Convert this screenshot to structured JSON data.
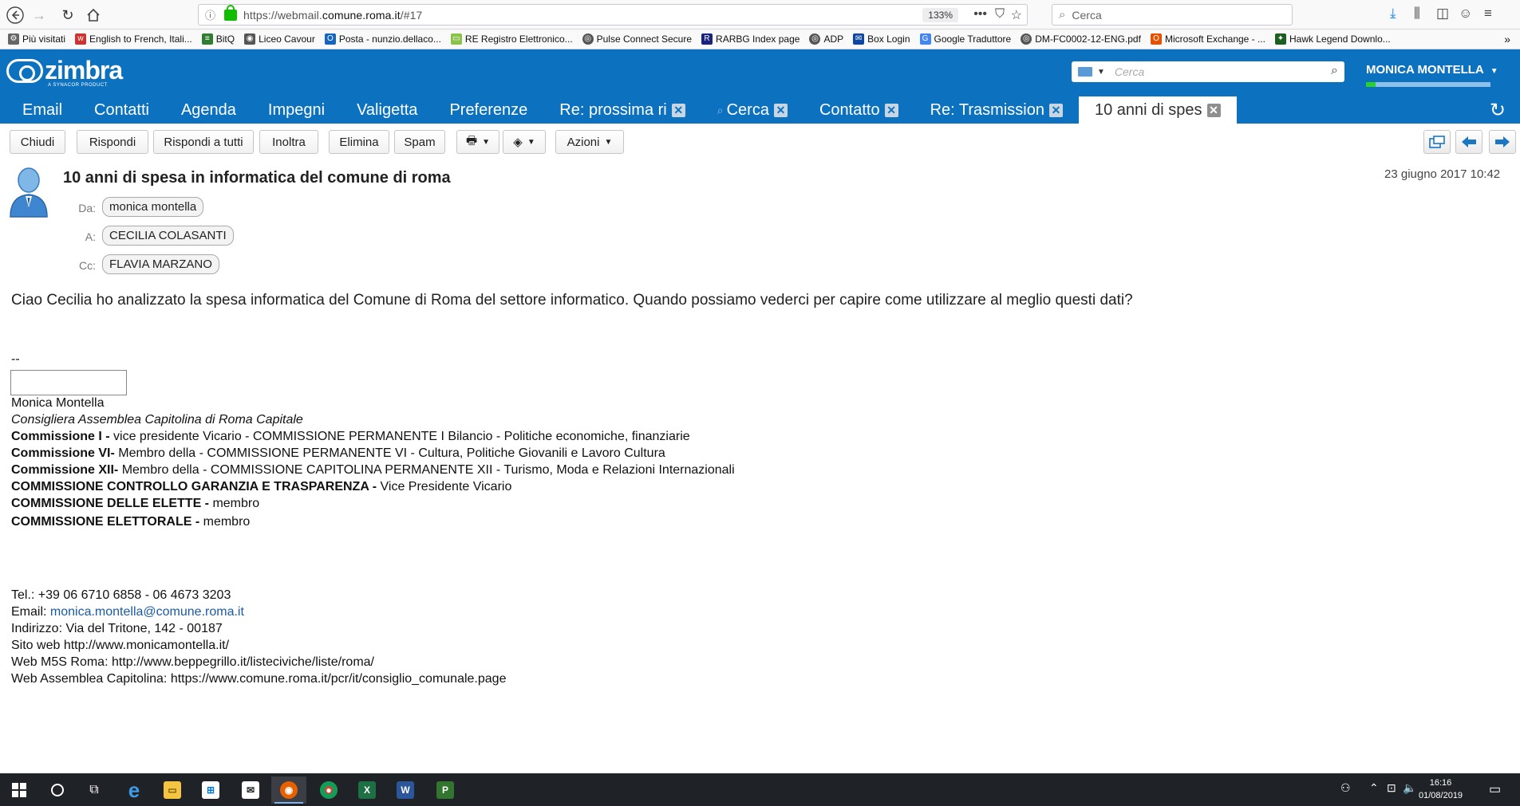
{
  "browser": {
    "url_prefix": "https://webmail.",
    "url_domain": "comune.roma.it",
    "url_suffix": "/#17",
    "zoom": "133%",
    "search_placeholder": "Cerca",
    "bookmarks": [
      {
        "label": "Più visitati",
        "icon": "gear-icon",
        "color": "#666666"
      },
      {
        "label": "English to French, Itali...",
        "icon": "wordreference-icon",
        "color": "#cc3333"
      },
      {
        "label": "BitQ",
        "icon": "bitq-icon",
        "color": "#2e7d32"
      },
      {
        "label": "Liceo Cavour",
        "icon": "school-icon",
        "color": "#555555"
      },
      {
        "label": "Posta - nunzio.dellaco...",
        "icon": "outlook-icon",
        "color": "#1565c0"
      },
      {
        "label": "RE Registro Elettronico...",
        "icon": "folder-icon",
        "color": "#8bc34a"
      },
      {
        "label": "Pulse Connect Secure",
        "icon": "globe-icon",
        "color": "#555555"
      },
      {
        "label": "RARBG Index page",
        "icon": "rarbg-icon",
        "color": "#1a237e"
      },
      {
        "label": "ADP",
        "icon": "globe-icon",
        "color": "#555555"
      },
      {
        "label": "Box Login",
        "icon": "box-icon",
        "color": "#0d47a1"
      },
      {
        "label": "Google Traduttore",
        "icon": "translate-icon",
        "color": "#4285f4"
      },
      {
        "label": "DM-FC0002-12-ENG.pdf",
        "icon": "globe-icon",
        "color": "#555555"
      },
      {
        "label": "Microsoft Exchange - ...",
        "icon": "exchange-icon",
        "color": "#e65100"
      },
      {
        "label": "Hawk Legend Downlo...",
        "icon": "hawk-icon",
        "color": "#1b5e20"
      }
    ]
  },
  "zimbra": {
    "logo": "zimbra",
    "logo_sub": "A SYNACOR PRODUCT",
    "search_placeholder": "Cerca",
    "user": "MONICA MONTELLA",
    "quota_fraction": 0.08,
    "tabs": [
      {
        "label": "Email",
        "closable": false,
        "active": false
      },
      {
        "label": "Contatti",
        "closable": false,
        "active": false
      },
      {
        "label": "Agenda",
        "closable": false,
        "active": false
      },
      {
        "label": "Impegni",
        "closable": false,
        "active": false
      },
      {
        "label": "Valigetta",
        "closable": false,
        "active": false
      },
      {
        "label": "Preferenze",
        "closable": false,
        "active": false
      },
      {
        "label": "Re: prossima ri",
        "closable": true,
        "active": false
      },
      {
        "label": "Cerca",
        "closable": true,
        "active": false
      },
      {
        "label": "Contatto",
        "closable": true,
        "active": false
      },
      {
        "label": "Re: Trasmission",
        "closable": true,
        "active": false
      },
      {
        "label": "10 anni di spes",
        "closable": true,
        "active": true
      }
    ]
  },
  "toolbar": {
    "close": "Chiudi",
    "reply": "Rispondi",
    "reply_all": "Rispondi a tutti",
    "forward": "Inoltra",
    "delete": "Elimina",
    "spam": "Spam",
    "actions": "Azioni"
  },
  "message": {
    "subject": "10 anni di spesa in informatica del comune di roma",
    "date": "23 giugno 2017 10:42",
    "from_label": "Da:",
    "from": "monica montella",
    "to_label": "A:",
    "to": "CECILIA COLASANTI",
    "cc_label": "Cc:",
    "cc": "FLAVIA MARZANO",
    "body": "Ciao Cecilia ho analizzato la spesa informatica del Comune di Roma del settore informatico. Quando possiamo vederci per capire come utilizzare al meglio questi dati?"
  },
  "signature": {
    "dashes": "--",
    "name": "Monica Montella",
    "role": "Consigliera Assemblea Capitolina di Roma Capitale",
    "lines": [
      {
        "bold": "Commissione I - ",
        "text": "vice presidente Vicario - COMMISSIONE PERMANENTE I Bilancio - Politiche economiche, finanziarie"
      },
      {
        "bold": "Commissione VI- ",
        "text": "Membro della - COMMISSIONE PERMANENTE VI - Cultura, Politiche Giovanili e Lavoro Cultura"
      },
      {
        "bold": "Commissione XII- ",
        "text": "Membro della - COMMISSIONE CAPITOLINA PERMANENTE XII - Turismo, Moda e Relazioni Internazionali"
      },
      {
        "bold": "COMMISSIONE CONTROLLO GARANZIA E TRASPARENZA - ",
        "text": "Vice Presidente Vicario"
      },
      {
        "bold": "COMMISSIONE DELLE ELETTE - ",
        "text": "membro"
      },
      {
        "bold": "COMMISSIONE ELETTORALE - ",
        "text": "membro"
      }
    ],
    "tel": "Tel.: +39 06 6710 6858 - 06 4673 3203",
    "email_label": "Email: ",
    "email": "monica.montella@comune.roma.it",
    "address": "Indirizzo: Via del Tritone, 142 - 00187",
    "site": "Sito web http://www.monicamontella.it/",
    "m5s": "Web M5S Roma: http://www.beppegrillo.it/listeciviche/liste/roma/",
    "assembly": "Web Assemblea Capitolina: https://www.comune.roma.it/pcr/it/consiglio_comunale.page"
  },
  "taskbar": {
    "time": "16:16",
    "date": "01/08/2019"
  }
}
